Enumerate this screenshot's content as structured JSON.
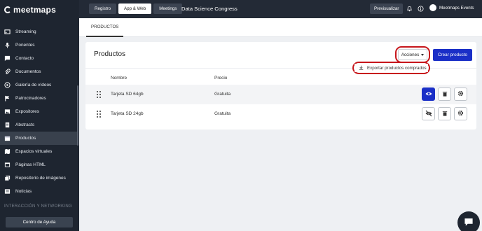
{
  "app": {
    "logo_text": "meetmaps"
  },
  "sidebar": {
    "items": [
      {
        "label": "Streaming",
        "icon": "streaming-icon"
      },
      {
        "label": "Ponentes",
        "icon": "microphone-icon"
      },
      {
        "label": "Contacto",
        "icon": "chat-icon"
      },
      {
        "label": "Documentos",
        "icon": "paperclip-icon"
      },
      {
        "label": "Galería de vídeos",
        "icon": "video-icon"
      },
      {
        "label": "Patrocinadores",
        "icon": "flag-icon"
      },
      {
        "label": "Expositores",
        "icon": "image-icon"
      },
      {
        "label": "Abstracts",
        "icon": "document-icon"
      },
      {
        "label": "Productos",
        "icon": "box-icon",
        "active": true
      },
      {
        "label": "Espacios virtuales",
        "icon": "map-icon"
      },
      {
        "label": "Páginas HTML",
        "icon": "layout-icon"
      },
      {
        "label": "Repositorio de imágenes",
        "icon": "images-icon"
      },
      {
        "label": "Noticias",
        "icon": "news-icon"
      }
    ],
    "section_label": "INTERACCIÓN Y NETWORKING",
    "help_label": "Centro de Ayuda"
  },
  "topbar": {
    "tabs": [
      {
        "label": "Registro"
      },
      {
        "label": "App & Web",
        "active": true
      },
      {
        "label": "Meetings"
      }
    ],
    "event_name": "Data Science Congress",
    "preview_label": "Previsualizar",
    "user_name": "Meetmaps Events"
  },
  "subtabs": {
    "active_label": "PRODUCTOS"
  },
  "card": {
    "title": "Productos",
    "actions_label": "Acciones",
    "create_label": "Crear producto",
    "dropdown_item": "Exportar productos comprados",
    "columns": {
      "name": "Nombre",
      "price": "Precio"
    },
    "rows": [
      {
        "name": "Tarjeta SD 64gb",
        "price": "Gratuita",
        "visible": true
      },
      {
        "name": "Tarjeta SD 24gb",
        "price": "Gratuita",
        "visible": false
      }
    ]
  },
  "colors": {
    "sidebar_bg": "#1e2530",
    "topbar_bg": "#232a36",
    "primary": "#1a2fc7",
    "highlight": "#c7161b"
  }
}
